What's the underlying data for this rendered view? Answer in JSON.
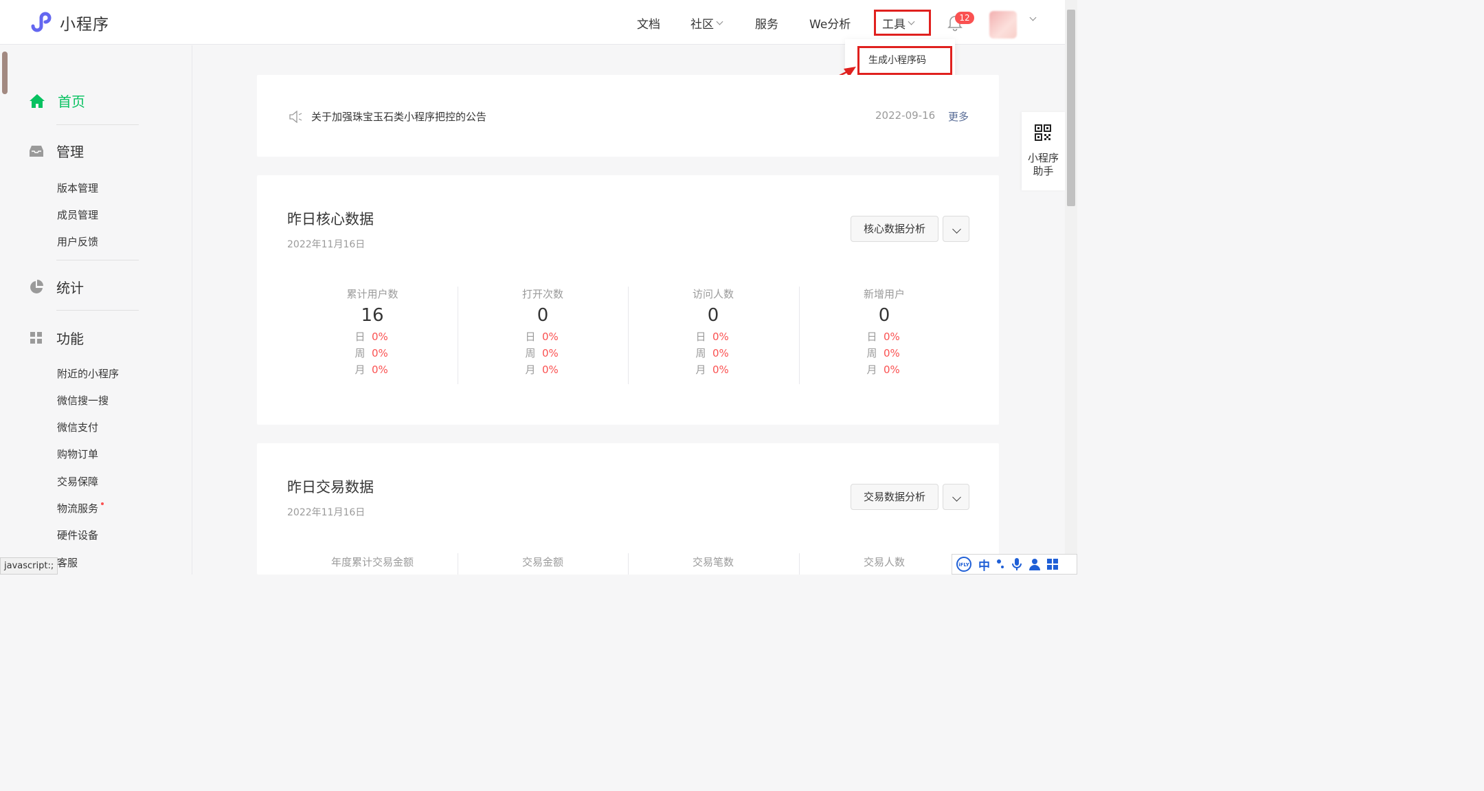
{
  "header": {
    "brand": "小程序",
    "nav": {
      "docs": "文档",
      "community": "社区",
      "service": "服务",
      "we_analysis": "We分析",
      "tools": "工具"
    },
    "notification_count": "12"
  },
  "tools_menu": {
    "items": [
      "生成小程序码"
    ]
  },
  "sidebar": {
    "home": "首页",
    "manage": "管理",
    "manage_items": [
      "版本管理",
      "成员管理",
      "用户反馈"
    ],
    "stats": "统计",
    "features": "功能",
    "feature_items": [
      "附近的小程序",
      "微信搜一搜",
      "微信支付",
      "购物订单",
      "交易保障",
      "物流服务",
      "硬件设备"
    ],
    "support": "客服"
  },
  "status_bar": "javascript:;",
  "notice": {
    "text": "关于加强珠宝玉石类小程序把控的公告",
    "date": "2022-09-16",
    "more": "更多"
  },
  "core": {
    "title": "昨日核心数据",
    "date": "2022年11月16日",
    "analysis_button": "核心数据分析",
    "metrics": [
      {
        "label": "累计用户数",
        "value": "16",
        "day": "0%",
        "week": "0%",
        "month": "0%"
      },
      {
        "label": "打开次数",
        "value": "0",
        "day": "0%",
        "week": "0%",
        "month": "0%"
      },
      {
        "label": "访问人数",
        "value": "0",
        "day": "0%",
        "week": "0%",
        "month": "0%"
      },
      {
        "label": "新增用户",
        "value": "0",
        "day": "0%",
        "week": "0%",
        "month": "0%"
      }
    ],
    "period_labels": {
      "day": "日",
      "week": "周",
      "month": "月"
    }
  },
  "trade": {
    "title": "昨日交易数据",
    "date": "2022年11月16日",
    "analysis_button": "交易数据分析",
    "metric_labels": [
      "年度累计交易金额",
      "交易金额",
      "交易笔数",
      "交易人数"
    ]
  },
  "helper": {
    "line1": "小程序",
    "line2": "助手"
  },
  "ime": {
    "lang": "中"
  },
  "colors": {
    "accent_green": "#07c160",
    "highlight_red": "#e0201e",
    "badge_red": "#fa5151",
    "link_blue": "#576b95"
  }
}
